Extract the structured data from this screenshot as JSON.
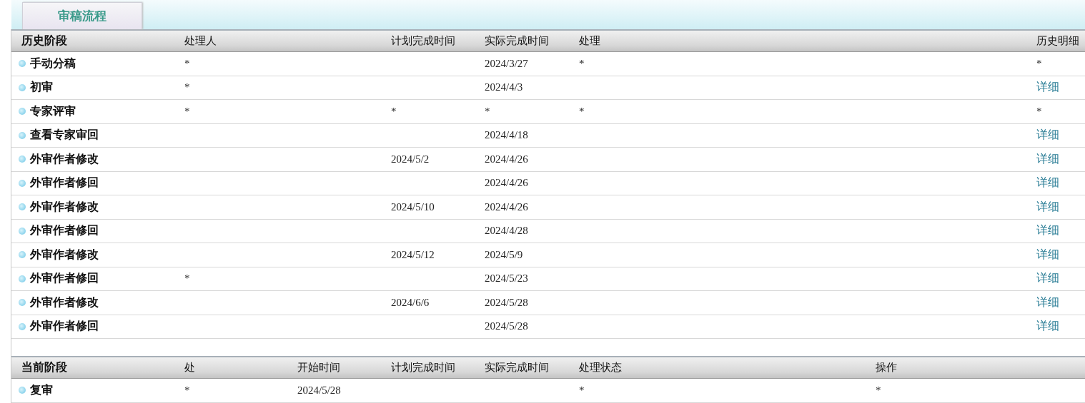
{
  "tab": {
    "label": "审稿流程",
    "selected": true
  },
  "history": {
    "columns": [
      "历史阶段",
      "处理人",
      "",
      "计划完成时间",
      "实际完成时间",
      "处理",
      "历史明细"
    ],
    "rows": [
      {
        "stage": "手动分稿",
        "handler": "*",
        "planned": "",
        "actual": "2024/3/27",
        "status": "*",
        "detail": {
          "text": "*",
          "kind": "text"
        }
      },
      {
        "stage": "初审",
        "handler": "*",
        "planned": "",
        "actual": "2024/4/3",
        "status": "",
        "detail": {
          "text": "详细",
          "kind": "link"
        }
      },
      {
        "stage": "专家评审",
        "handler": "*",
        "planned": "*",
        "actual": "*",
        "status": "*",
        "detail": {
          "text": "*",
          "kind": "text"
        }
      },
      {
        "stage": "查看专家审回",
        "handler": "",
        "planned": "",
        "actual": "2024/4/18",
        "status": "",
        "detail": {
          "text": "详细",
          "kind": "link"
        }
      },
      {
        "stage": "外审作者修改",
        "handler": "",
        "planned": "2024/5/2",
        "actual": "2024/4/26",
        "status": "",
        "detail": {
          "text": "详细",
          "kind": "link"
        }
      },
      {
        "stage": "外审作者修回",
        "handler": "",
        "planned": "",
        "actual": "2024/4/26",
        "status": "",
        "detail": {
          "text": "详细",
          "kind": "link"
        }
      },
      {
        "stage": "外审作者修改",
        "handler": "",
        "planned": "2024/5/10",
        "actual": "2024/4/26",
        "status": "",
        "detail": {
          "text": "详细",
          "kind": "link"
        }
      },
      {
        "stage": "外审作者修回",
        "handler": "",
        "planned": "",
        "actual": "2024/4/28",
        "status": "",
        "detail": {
          "text": "详细",
          "kind": "link"
        }
      },
      {
        "stage": "外审作者修改",
        "handler": "",
        "planned": "2024/5/12",
        "actual": "2024/5/9",
        "status": "",
        "detail": {
          "text": "详细",
          "kind": "link"
        }
      },
      {
        "stage": "外审作者修回",
        "handler": "*",
        "planned": "",
        "actual": "2024/5/23",
        "status": "",
        "detail": {
          "text": "详细",
          "kind": "link"
        }
      },
      {
        "stage": "外审作者修改",
        "handler": "",
        "planned": "2024/6/6",
        "actual": "2024/5/28",
        "status": "",
        "detail": {
          "text": "详细",
          "kind": "link"
        }
      },
      {
        "stage": "外审作者修回",
        "handler": "",
        "planned": "",
        "actual": "2024/5/28",
        "status": "",
        "detail": {
          "text": "详细",
          "kind": "link"
        }
      }
    ]
  },
  "current": {
    "columns": [
      "当前阶段",
      "处",
      "开始时间",
      "计划完成时间",
      "实际完成时间",
      "处理状态",
      "操作"
    ],
    "rows": [
      {
        "stage": "复审",
        "handler": "*",
        "start": "2024/5/28",
        "planned": "",
        "actual": "",
        "status": "*",
        "action": "*"
      }
    ]
  }
}
